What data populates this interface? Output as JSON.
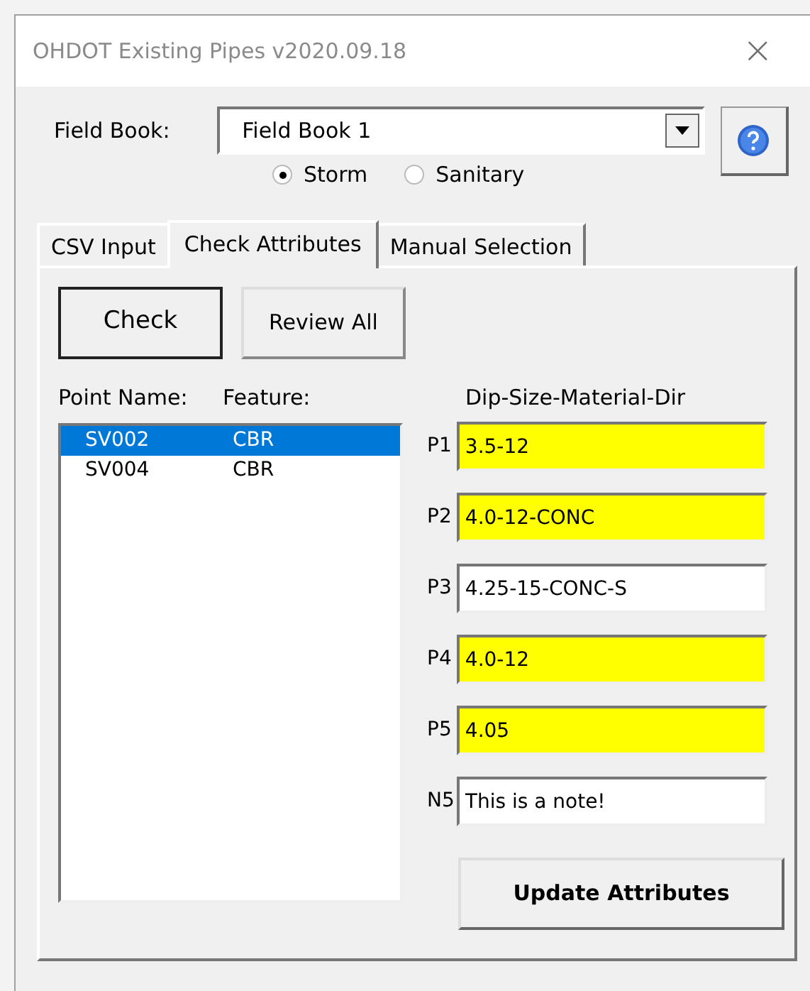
{
  "window": {
    "title": "OHDOT Existing Pipes v2020.09.18",
    "close": "×"
  },
  "field_book": {
    "label": "Field Book:",
    "value": "Field Book 1"
  },
  "network_type": [
    {
      "label": "Storm",
      "selected": true
    },
    {
      "label": "Sanitary",
      "selected": false
    }
  ],
  "tabs": [
    {
      "label": "CSV Input",
      "selected": false
    },
    {
      "label": "Check Attributes",
      "selected": true
    },
    {
      "label": "Manual Selection",
      "selected": false
    }
  ],
  "buttons": [
    "Check",
    "Review All"
  ],
  "points": {
    "columns": [
      "Point Name:",
      "Feature:"
    ],
    "rows": [
      {
        "name": "SV002",
        "feature": "CBR",
        "selected": true
      },
      {
        "name": "SV004",
        "feature": "CBR",
        "selected": false
      }
    ]
  },
  "attributes": {
    "heading": "Dip-Size-Material-Dir",
    "fields": [
      {
        "label": "P1",
        "value": "3.5-12",
        "highlighted": true
      },
      {
        "label": "P2",
        "value": "4.0-12-CONC",
        "highlighted": true
      },
      {
        "label": "P3",
        "value": "4.25-15-CONC-S",
        "highlighted": false
      },
      {
        "label": "P4",
        "value": "4.0-12",
        "highlighted": true
      },
      {
        "label": "P5",
        "value": "4.05",
        "highlighted": true
      },
      {
        "label": "N5",
        "value": "This is a note!",
        "highlighted": false
      }
    ]
  },
  "update_button": "Update Attributes"
}
